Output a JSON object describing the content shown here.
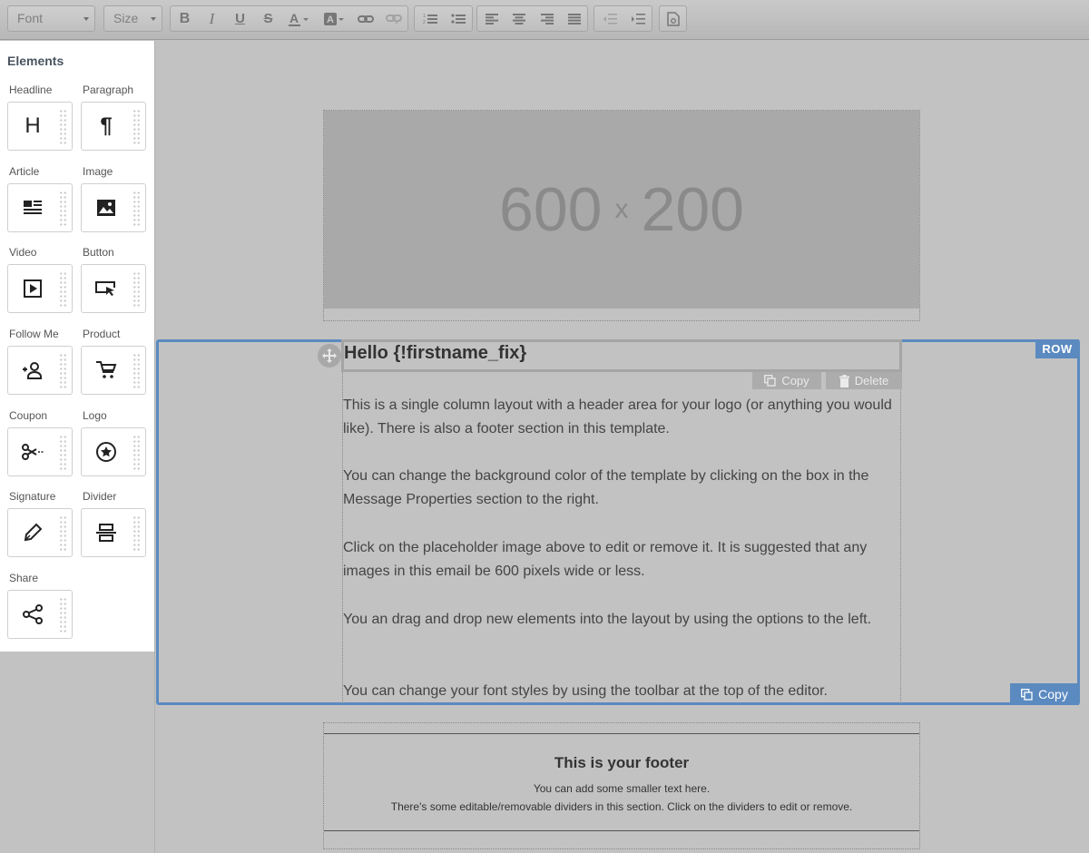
{
  "toolbar": {
    "font_label": "Font",
    "size_label": "Size"
  },
  "sidebar": {
    "title": "Elements",
    "items": [
      {
        "label": "Headline",
        "icon": "headline-icon"
      },
      {
        "label": "Paragraph",
        "icon": "paragraph-icon"
      },
      {
        "label": "Article",
        "icon": "article-icon"
      },
      {
        "label": "Image",
        "icon": "image-icon"
      },
      {
        "label": "Video",
        "icon": "video-icon"
      },
      {
        "label": "Button",
        "icon": "button-cursor-icon"
      },
      {
        "label": "Follow Me",
        "icon": "follow-person-icon"
      },
      {
        "label": "Product",
        "icon": "cart-icon"
      },
      {
        "label": "Coupon",
        "icon": "scissors-icon"
      },
      {
        "label": "Logo",
        "icon": "star-badge-icon"
      },
      {
        "label": "Signature",
        "icon": "pen-icon"
      },
      {
        "label": "Divider",
        "icon": "divider-icon"
      },
      {
        "label": "Share",
        "icon": "share-icon"
      }
    ]
  },
  "hero": {
    "width_text": "600",
    "times": "x",
    "height_text": "200"
  },
  "row": {
    "tag": "ROW",
    "copy_label": "Copy"
  },
  "headline": {
    "text": "Hello {!firstname_fix}",
    "copy_label": "Copy",
    "delete_label": "Delete"
  },
  "paragraphs": [
    "This is a single column layout with a header area for your logo (or anything you would like). There is also a footer section in this template.",
    "You can change the background color of the template by clicking on the box in the Message Properties section to the right.",
    "Click on the placeholder image above to edit or remove it. It is suggested that any images in this email be 600 pixels wide or less.",
    "You an drag and drop new elements into the layout by using the options to the left.",
    "You can change your font styles by using the toolbar at the top of the editor."
  ],
  "footer": {
    "title": "This is your footer",
    "line1": "You can add some smaller text here.",
    "line2": "There's some editable/removable dividers in this section. Click on the dividers to edit or remove."
  },
  "colors": {
    "accent": "#5b8ac0",
    "canvas": "#c2c2c2"
  }
}
